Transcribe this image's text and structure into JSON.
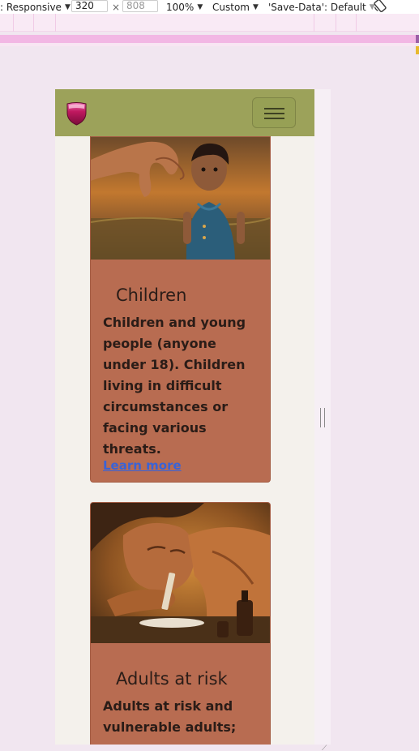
{
  "devtools": {
    "device_label": ": Responsive",
    "width_value": "320",
    "times": "×",
    "height_placeholder": "808",
    "zoom_label": "100%",
    "throttle_label": "Custom",
    "savedata_label": "'Save-Data': Default"
  },
  "navbar": {
    "background": "#9ca25a"
  },
  "cards": [
    {
      "title": "Children",
      "text": "Children and young people (anyone under 18). Children living in difficult circumstances or facing various threats.",
      "link": "Learn more"
    },
    {
      "title": "Adults at risk",
      "text": "Adults at risk and vulnerable adults;"
    }
  ],
  "colors": {
    "card_bg": "#b86c51",
    "page_bg": "#f4f1ec",
    "link": "#3a63d6"
  }
}
